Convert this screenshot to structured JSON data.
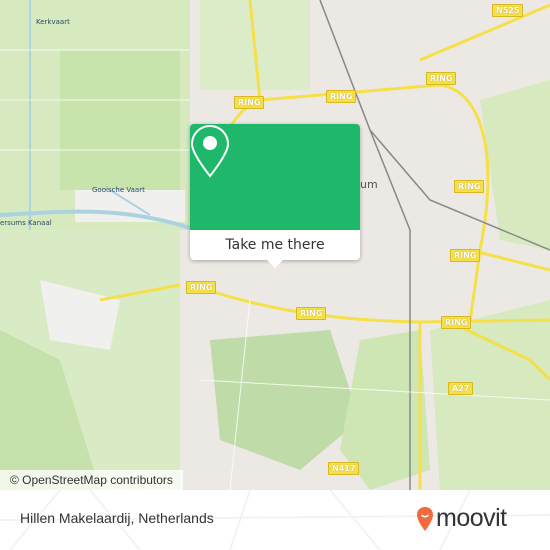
{
  "map": {
    "attribution": "© OpenStreetMap contributors",
    "city_label": "um",
    "water_labels": [
      "Kerkvaart",
      "Gooische Vaart",
      "ersums Kanaal"
    ],
    "road_shields": [
      "N525",
      "RING",
      "RING",
      "RING",
      "RING",
      "RING",
      "RING",
      "RING",
      "RING",
      "A27",
      "N417"
    ],
    "colors": {
      "land": "#ece9e4",
      "green": "#d6e9bf",
      "forest": "#bfdca8",
      "road": "#f5e04a",
      "water": "#aad3df"
    }
  },
  "popup": {
    "button_label": "Take me there",
    "icon": "map-pin-icon",
    "color": "#1fb86b"
  },
  "footer": {
    "place_name": "Hillen Makelaardij, Netherlands",
    "logo_text": "moovit",
    "logo_color": "#f26a3c"
  }
}
